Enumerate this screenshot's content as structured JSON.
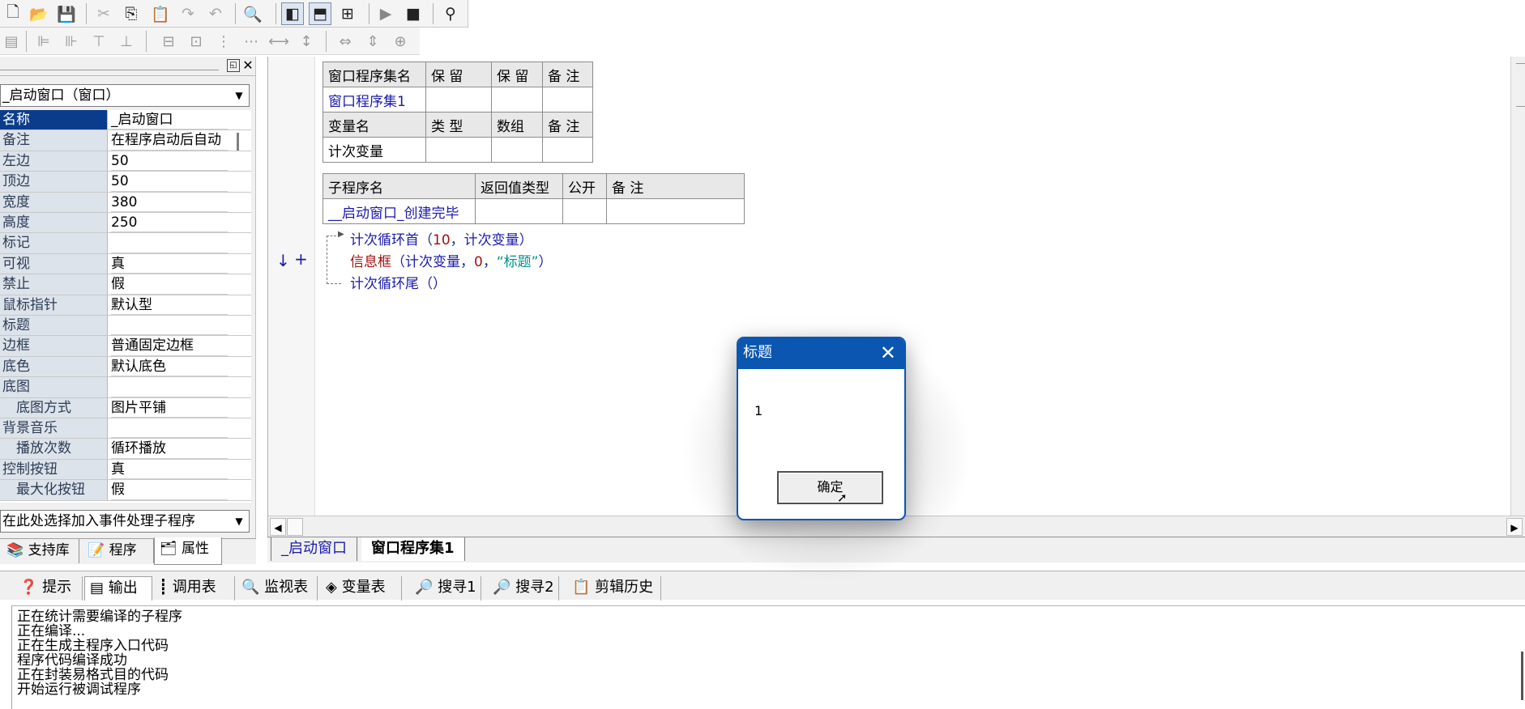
{
  "left_panel": {
    "object_combo": "_启动窗口（窗口）",
    "properties": [
      {
        "name": "名称",
        "value": "_启动窗口"
      },
      {
        "name": "备注",
        "value": "在程序启动后自动"
      },
      {
        "name": "左边",
        "value": "50"
      },
      {
        "name": "顶边",
        "value": "50"
      },
      {
        "name": "宽度",
        "value": "380"
      },
      {
        "name": "高度",
        "value": "250"
      },
      {
        "name": "标记",
        "value": ""
      },
      {
        "name": "可视",
        "value": "真"
      },
      {
        "name": "禁止",
        "value": "假"
      },
      {
        "name": "鼠标指针",
        "value": "默认型"
      },
      {
        "name": "标题",
        "value": ""
      },
      {
        "name": "边框",
        "value": "普通固定边框"
      },
      {
        "name": "底色",
        "value": "默认底色"
      },
      {
        "name": "底图",
        "value": ""
      },
      {
        "name": "底图方式",
        "value": "图片平铺"
      },
      {
        "name": "背景音乐",
        "value": ""
      },
      {
        "name": "播放次数",
        "value": "循环播放"
      },
      {
        "name": "控制按钮",
        "value": "真"
      },
      {
        "name": "最大化按钮",
        "value": "假"
      }
    ],
    "event_combo": "在此处选择加入事件处理子程序",
    "tabs": [
      "支持库",
      "程序",
      "属性"
    ]
  },
  "editor": {
    "assembly_table": {
      "headers": [
        "窗口程序集名",
        "保 留",
        "保 留",
        "备 注"
      ],
      "row": [
        "窗口程序集1",
        "",
        "",
        ""
      ],
      "var_headers": [
        "变量名",
        "类 型",
        "数组",
        "备 注"
      ],
      "var_row": [
        "计次变量",
        "",
        "",
        ""
      ]
    },
    "sub_table": {
      "headers": [
        "子程序名",
        "返回值类型",
        "公开",
        "备 注"
      ],
      "row": [
        "__启动窗口_创建完毕",
        "",
        "",
        ""
      ]
    },
    "code_lines": {
      "loop_start_kw": "计次循环首",
      "loop_start_open": "（",
      "loop_start_num": "10",
      "loop_start_rest": "，计次变量）",
      "msgbox_kw": "信息框",
      "msgbox_a": "（计次变量，",
      "msgbox_num": "0",
      "msgbox_b": "，",
      "msgbox_str": "“标题”",
      "msgbox_c": "）",
      "loop_end": "计次循环尾（）"
    },
    "tabs": [
      "_启动窗口",
      "窗口程序集1"
    ]
  },
  "output": {
    "tabs": [
      "提示",
      "输出",
      "调用表",
      "监视表",
      "变量表",
      "搜寻1",
      "搜寻2",
      "剪辑历史"
    ],
    "lines": [
      "正在统计需要编译的子程序",
      "正在编译...",
      "正在生成主程序入口代码",
      "程序代码编译成功",
      "正在封装易格式目的代码",
      "开始运行被调试程序"
    ]
  },
  "dialog": {
    "title": "标题",
    "message": "1",
    "ok_label": "确定"
  },
  "colors": {
    "dialog_title_bg": "#0a56b0",
    "keyword_blue": "#1a1aa8",
    "keyword_red": "#a01010",
    "string_teal": "#009090",
    "selected_row": "#0b3c8c"
  }
}
